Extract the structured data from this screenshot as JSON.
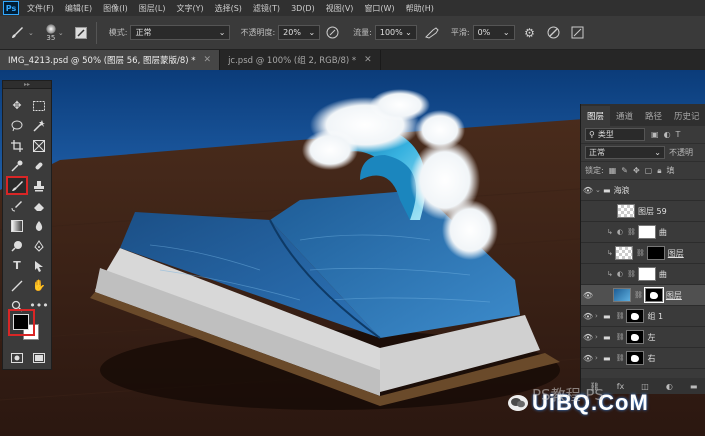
{
  "app": {
    "logo": "Ps",
    "menu": [
      "文件(F)",
      "编辑(E)",
      "图像(I)",
      "图层(L)",
      "文字(Y)",
      "选择(S)",
      "滤镜(T)",
      "3D(D)",
      "视图(V)",
      "窗口(W)",
      "帮助(H)"
    ]
  },
  "options": {
    "brush_size": "35",
    "mode_label": "模式:",
    "mode_value": "正常",
    "opacity_label": "不透明度:",
    "opacity_value": "20%",
    "flow_label": "流量:",
    "flow_value": "100%",
    "smoothing_label": "平滑:",
    "smoothing_value": "0%"
  },
  "tabs": [
    {
      "label": "IMG_4213.psd @ 50% (图层 56, 图层蒙版/8) *",
      "active": true
    },
    {
      "label": "jc.psd @ 100% (组 2, RGB/8) *",
      "active": false
    }
  ],
  "layers_panel": {
    "tabs": [
      "图层",
      "通道",
      "路径",
      "历史记"
    ],
    "filter_label": "类型",
    "blend_mode": "正常",
    "opacity_label": "不透明",
    "lock_label": "锁定:",
    "fill_label": "填",
    "layers": [
      {
        "name": "海浪",
        "type": "group"
      },
      {
        "name": "图层 59"
      },
      {
        "name": "曲"
      },
      {
        "name": "图层"
      },
      {
        "name": "曲"
      },
      {
        "name": "图层"
      },
      {
        "name": "组 1",
        "type": "group"
      },
      {
        "name": "左",
        "type": "group"
      },
      {
        "name": "右",
        "type": "group"
      }
    ]
  },
  "watermark": {
    "text": "UiBQ.CoM",
    "behind_text": "PS教程 PS"
  },
  "colors": {
    "highlight": "#d92626",
    "foreground": "#000000",
    "background": "#ffffff"
  }
}
